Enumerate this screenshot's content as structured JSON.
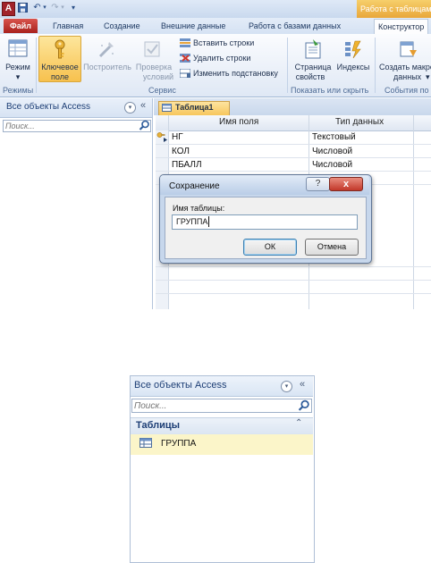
{
  "app": {
    "icon_letter": "A",
    "context_tab_title": "Работа с таблицами"
  },
  "ribbon_tabs": {
    "file": "Файл",
    "home": "Главная",
    "create": "Создание",
    "external": "Внешние данные",
    "database": "Работа с базами данных",
    "design": "Конструктор"
  },
  "ribbon": {
    "view_l1": "Режим",
    "key_l1": "Ключевое",
    "key_l2": "поле",
    "builder": "Построитель",
    "validate_l1": "Проверка",
    "validate_l2": "условий",
    "insert_rows": "Вставить строки",
    "delete_rows": "Удалить строки",
    "modify_lookups": "Изменить подстановку",
    "prop_sheet_l1": "Страница",
    "prop_sheet_l2": "свойств",
    "indexes": "Индексы",
    "create_macro_l1": "Создать макро",
    "create_macro_l2": "данных",
    "group_views": "Режимы",
    "group_tools": "Сервис",
    "group_showhide": "Показать или скрыть",
    "group_events": "События по"
  },
  "nav_top": {
    "title": "Все объекты Access",
    "search_placeholder": "Поиск..."
  },
  "designer": {
    "tab_label": "Таблица1",
    "col_field": "Имя поля",
    "col_type": "Тип данных",
    "rows": [
      {
        "field": "НГ",
        "type": "Текстовый"
      },
      {
        "field": "КОЛ",
        "type": "Числовой"
      },
      {
        "field": "ПБАЛЛ",
        "type": "Числовой"
      }
    ]
  },
  "dialog": {
    "title": "Сохранение",
    "help": "?",
    "close": "x",
    "label": "Имя таблицы:",
    "value": "ГРУППА",
    "ok": "ОК",
    "cancel": "Отмена"
  },
  "nav_bottom": {
    "title": "Все объекты Access",
    "search_placeholder": "Поиск...",
    "group": "Таблицы",
    "items": [
      "ГРУППА"
    ]
  }
}
